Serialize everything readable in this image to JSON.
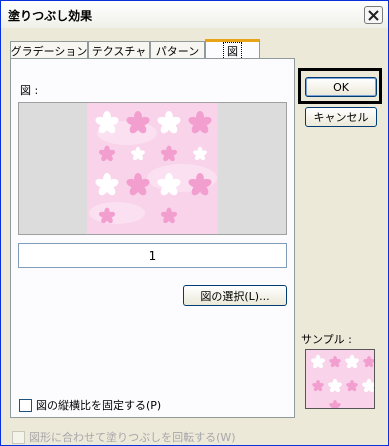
{
  "window": {
    "title": "塗りつぶし効果"
  },
  "tabs": [
    {
      "label": "グラデーション"
    },
    {
      "label": "テクスチャ"
    },
    {
      "label": "パターン"
    },
    {
      "label": "図"
    }
  ],
  "picture": {
    "label": "図 :",
    "page_number": "1",
    "select_button": "図の選択(L)...",
    "lock_ratio_label": "図の縦横比を固定する(P)"
  },
  "buttons": {
    "ok": "OK",
    "cancel": "キャンセル"
  },
  "sample": {
    "label": "サンプル :"
  },
  "rotate_option": {
    "label": "図形に合わせて塗りつぶしを回転する(W)"
  },
  "colors": {
    "pattern_bg": "#f8d3ea",
    "flower_pink": "#f29fd0",
    "flower_white": "#ffffff"
  }
}
